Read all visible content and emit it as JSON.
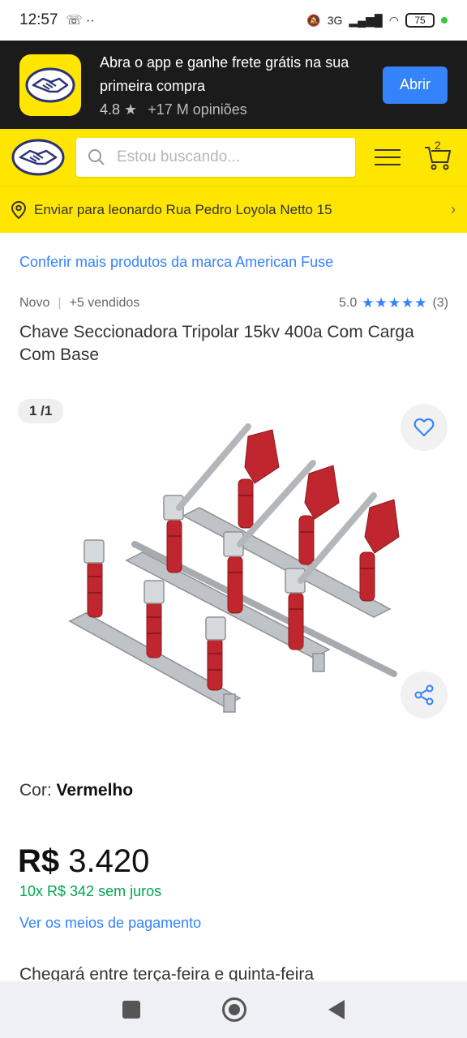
{
  "status_bar": {
    "time": "12:57",
    "network": "3G",
    "battery": "75"
  },
  "app_banner": {
    "message": "Abra o app e ganhe frete grátis na sua primeira compra",
    "rating": "4.8",
    "reviews": "+17 M opiniões",
    "open_label": "Abrir"
  },
  "search": {
    "placeholder": "Estou buscando..."
  },
  "cart": {
    "count": "2"
  },
  "address": {
    "label": "Enviar para leonardo Rua Pedro Loyola Netto 15"
  },
  "product": {
    "brand_link": "Conferir mais produtos da marca American Fuse",
    "condition": "Novo",
    "sold": "+5 vendidos",
    "rating": "5.0",
    "reviews": "(3)",
    "title": "Chave Seccionadora Tripolar 15kv 400a Com Carga Com Base",
    "image_counter": "1 /1",
    "color_label": "Cor:",
    "color_value": "Vermelho",
    "price_currency": "R$",
    "price_value": "3.420",
    "installments": "10x R$ 342 sem juros",
    "payment_link": "Ver os meios de pagamento",
    "delivery": "Chegará entre terça-feira e quinta-feira"
  },
  "colors": {
    "brand_yellow": "#ffe600",
    "accent_blue": "#3483fa",
    "green": "#00a650",
    "insulator_red": "#c0262d"
  }
}
